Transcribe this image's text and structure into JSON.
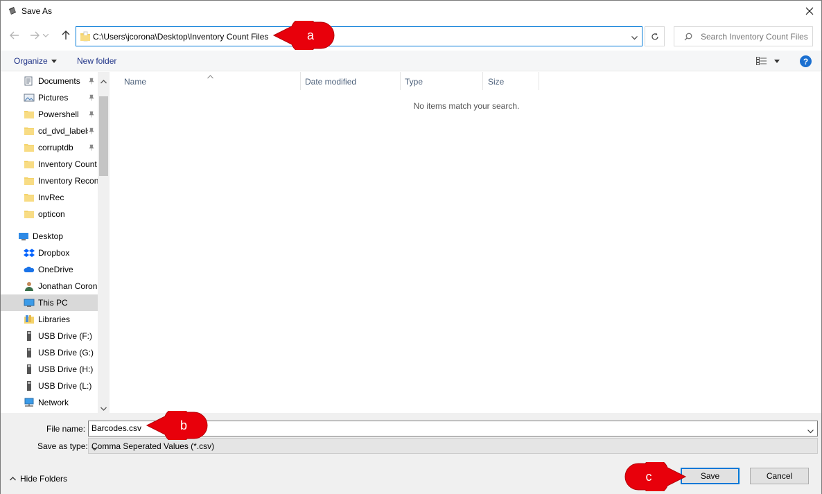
{
  "window": {
    "title": "Save As"
  },
  "address": {
    "path": "C:\\Users\\jcorona\\Desktop\\Inventory Count Files",
    "search_placeholder": "Search Inventory Count Files"
  },
  "toolbar": {
    "organize": "Organize",
    "new_folder": "New folder",
    "help": "?"
  },
  "nav": {
    "items": [
      {
        "label": "Documents",
        "icon": "documents-icon",
        "pinned": true
      },
      {
        "label": "Pictures",
        "icon": "pictures-icon",
        "pinned": true
      },
      {
        "label": "Powershell",
        "icon": "folder-icon",
        "pinned": true
      },
      {
        "label": "cd_dvd_labels",
        "icon": "folder-icon",
        "pinned": true
      },
      {
        "label": "corruptdb",
        "icon": "folder-icon",
        "pinned": true
      },
      {
        "label": "Inventory Count",
        "icon": "folder-icon",
        "pinned": false
      },
      {
        "label": "Inventory Recon",
        "icon": "folder-icon",
        "pinned": false
      },
      {
        "label": "InvRec",
        "icon": "folder-icon",
        "pinned": false
      },
      {
        "label": "opticon",
        "icon": "folder-icon",
        "pinned": false
      },
      {
        "label": "Desktop",
        "icon": "desktop-icon",
        "pinned": false
      },
      {
        "label": "Dropbox",
        "icon": "dropbox-icon",
        "pinned": false
      },
      {
        "label": "OneDrive",
        "icon": "onedrive-icon",
        "pinned": false
      },
      {
        "label": "Jonathan Corona",
        "icon": "user-icon",
        "pinned": false
      },
      {
        "label": "This PC",
        "icon": "computer-icon",
        "pinned": false,
        "selected": true
      },
      {
        "label": "Libraries",
        "icon": "libraries-icon",
        "pinned": false
      },
      {
        "label": "USB Drive (F:)",
        "icon": "usb-drive-icon",
        "pinned": false
      },
      {
        "label": "USB Drive (G:)",
        "icon": "usb-drive-icon",
        "pinned": false
      },
      {
        "label": "USB Drive (H:)",
        "icon": "usb-drive-icon",
        "pinned": false
      },
      {
        "label": "USB Drive (L:)",
        "icon": "usb-drive-icon",
        "pinned": false
      },
      {
        "label": "Network",
        "icon": "network-icon",
        "pinned": false
      }
    ]
  },
  "content": {
    "columns": [
      "Name",
      "Date modified",
      "Type",
      "Size"
    ],
    "empty_message": "No items match your search."
  },
  "form": {
    "file_name_label": "File name:",
    "file_name_value": "Barcodes.csv",
    "save_type_label": "Save as type:",
    "save_type_value": "Comma Seperated Values (*.csv)"
  },
  "footer": {
    "hide_folders": "Hide Folders",
    "save": "Save",
    "cancel": "Cancel"
  },
  "callouts": {
    "a": "a",
    "b": "b",
    "c": "c",
    "color": "#e8000b"
  }
}
